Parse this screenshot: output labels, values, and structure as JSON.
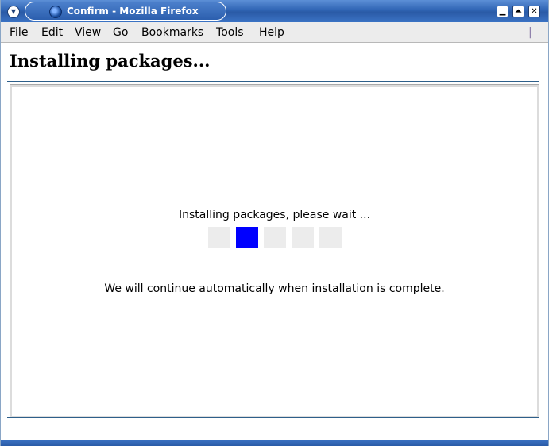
{
  "window": {
    "title": "Confirm - Mozilla Firefox",
    "buttons": {
      "minimize_icon": "minimize-icon",
      "maximize_icon": "maximize-icon",
      "close_icon": "close-icon"
    }
  },
  "menubar": {
    "items": [
      {
        "label": "File",
        "accel": "F",
        "rest": "ile"
      },
      {
        "label": "Edit",
        "accel": "E",
        "rest": "dit"
      },
      {
        "label": "View",
        "accel": "V",
        "rest": "iew"
      },
      {
        "label": "Go",
        "accel": "G",
        "rest": "o"
      },
      {
        "label": "Bookmarks",
        "accel": "B",
        "rest": "ookmarks"
      },
      {
        "label": "Tools",
        "accel": "T",
        "rest": "ools"
      },
      {
        "label": "Help",
        "accel": "H",
        "rest": "elp"
      }
    ]
  },
  "page": {
    "title": "Installing packages...",
    "status": "Installing packages, please wait ...",
    "note": "We will continue automatically when installation is complete."
  },
  "progress": {
    "cells": 5,
    "active_index": 1,
    "active_color": "#0000ff",
    "inactive_color": "#ececec"
  }
}
